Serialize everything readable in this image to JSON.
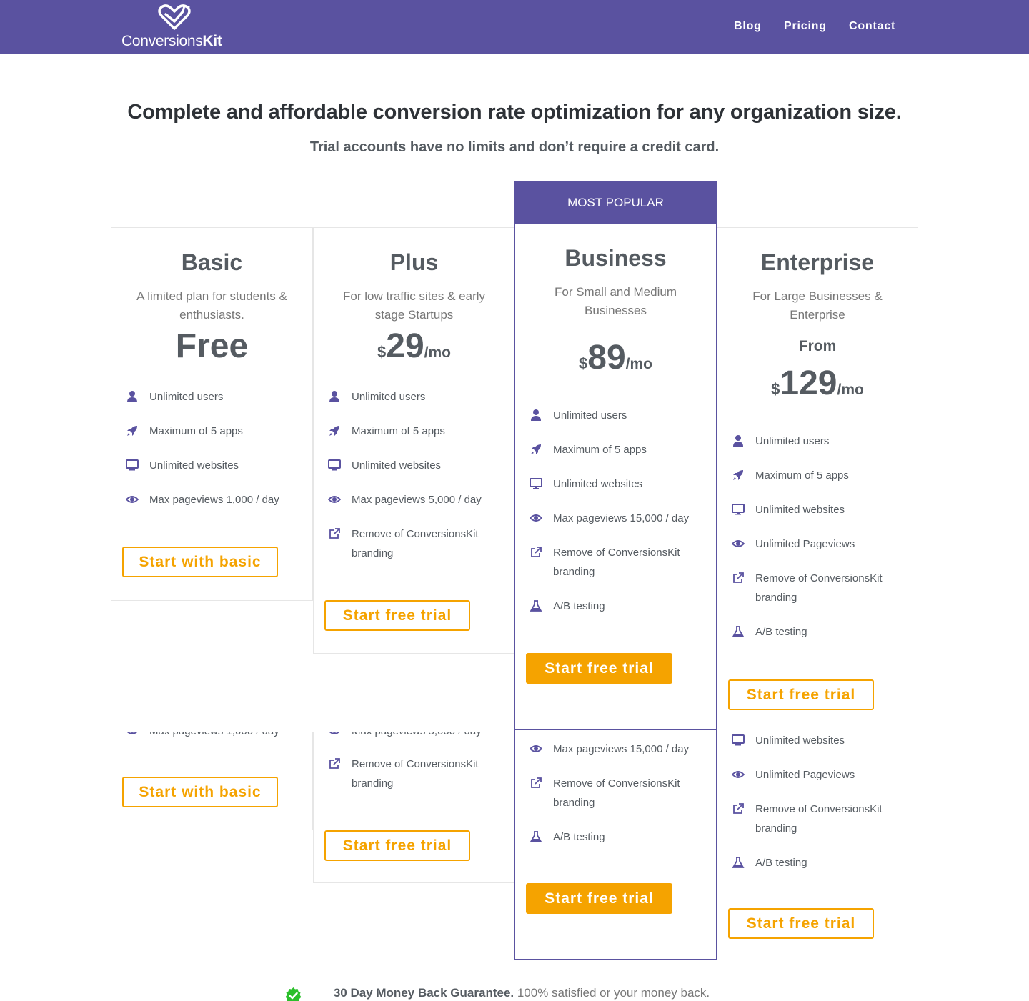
{
  "header": {
    "logo_regular": "Conversions",
    "logo_bold": "Kit",
    "nav": [
      "Blog",
      "Pricing",
      "Contact"
    ]
  },
  "hero": {
    "title": "Complete and affordable conversion rate optimization for any organization size.",
    "subtitle": "Trial accounts have no limits and don’t require a credit card."
  },
  "badge": "MOST POPULAR",
  "plans": {
    "basic": {
      "name": "Basic",
      "description": "A limited plan for students & enthusiasts.",
      "price_label": "Free",
      "features": [
        "Unlimited users",
        "Maximum of 5 apps",
        "Unlimited websites",
        "Max pageviews 1,000 / day"
      ],
      "button": "Start with basic"
    },
    "plus": {
      "name": "Plus",
      "description": "For low traffic sites & early stage Startups",
      "currency": "$",
      "price": "29",
      "period": "/mo",
      "features": [
        "Unlimited users",
        "Maximum of 5 apps",
        "Unlimited websites",
        "Max pageviews 5,000 / day",
        "Remove of ConversionsKit branding"
      ],
      "button": "Start free trial"
    },
    "business": {
      "name": "Business",
      "description": "For Small and Medium Businesses",
      "currency": "$",
      "price": "89",
      "period": "/mo",
      "features": [
        "Unlimited users",
        "Maximum of 5 apps",
        "Unlimited websites",
        "Max pageviews 15,000 / day",
        "Remove of ConversionsKit branding",
        "A/B testing"
      ],
      "button": "Start free trial"
    },
    "enterprise": {
      "name": "Enterprise",
      "description": "For Large Businesses & Enterprise",
      "from": "From",
      "currency": "$",
      "price": "129",
      "period": "/mo",
      "features": [
        "Unlimited users",
        "Maximum of 5 apps",
        "Unlimited websites",
        "Unlimited Pageviews",
        "Remove of ConversionsKit branding",
        "A/B testing"
      ],
      "button": "Start free trial"
    }
  },
  "guarantee": {
    "bold": "30 Day Money Back Guarantee.",
    "text": " 100% satisfied or your money back."
  },
  "colors": {
    "brand": "#5a52a0",
    "accent": "#f5a300",
    "check": "#2bbf2b"
  }
}
